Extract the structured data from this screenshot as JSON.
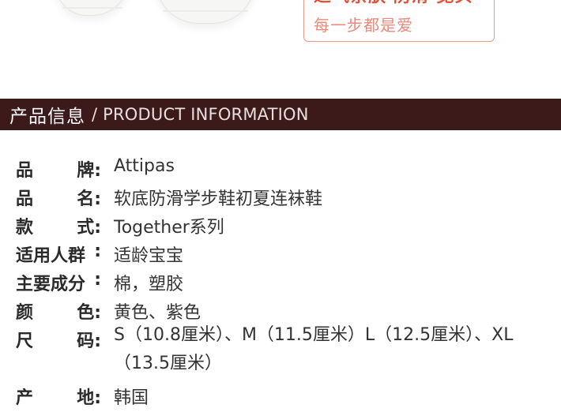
{
  "slogan": {
    "top": "适气亲肤 防滑 宽头",
    "sub": "每一步都是爱"
  },
  "section_bar": {
    "title_cn": "产品信息",
    "title_en": "/ PRODUCT INFORMATION"
  },
  "product_info": [
    {
      "label_a": "品",
      "label_b": "牌:",
      "value": "Attipas"
    },
    {
      "label_a": "品",
      "label_b": "名:",
      "value": "软底防滑学步鞋初夏连袜鞋"
    },
    {
      "label_a": "款",
      "label_b": "式:",
      "value": "Together系列"
    },
    {
      "label_a": "适用人群",
      "label_b": ":",
      "value": "适龄宝宝"
    },
    {
      "label_a": "主要成分",
      "label_b": ":",
      "value": "棉，塑胶"
    },
    {
      "label_a": "颜",
      "label_b": "色:",
      "value": "黄色、紫色"
    },
    {
      "label_a": "尺",
      "label_b": "码:",
      "value": " S（10.8厘米）、M（11.5厘米）L（12.5厘米）、XL（13.5厘米）"
    },
    {
      "label_a": "产",
      "label_b": "地:",
      "value": "韩国"
    }
  ]
}
